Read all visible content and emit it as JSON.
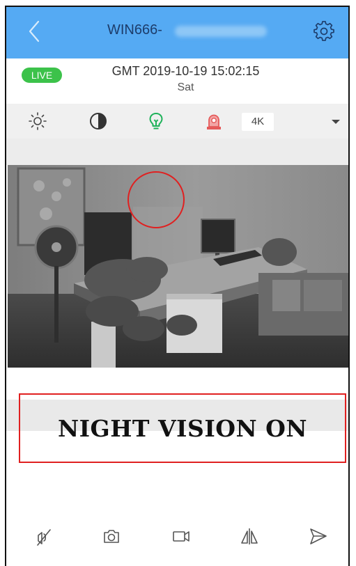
{
  "header": {
    "title": "WIN666-",
    "back_icon": "chevron-left-icon",
    "settings_icon": "gear-icon",
    "background_color": "#55aaf3"
  },
  "status": {
    "live_label": "LIVE",
    "datetime": "GMT 2019-10-19 15:02:15",
    "weekday": "Sat",
    "live_color": "#3cc24a"
  },
  "toolbar": {
    "icons": [
      "brightness-icon",
      "contrast-icon",
      "night-vision-bulb-icon",
      "alarm-siren-icon"
    ],
    "resolution_label": "4K",
    "dropdown_icon": "caret-down-icon",
    "bulb_color": "#1fb25a",
    "siren_color": "#e55a5a"
  },
  "annotation": {
    "label": "NIGHT VISION ON",
    "box_color": "#e02020"
  },
  "bottom_bar": {
    "icons": [
      "talk-mute-icon",
      "snapshot-camera-icon",
      "record-video-icon",
      "flip-mirror-icon",
      "send-ptz-icon"
    ]
  }
}
